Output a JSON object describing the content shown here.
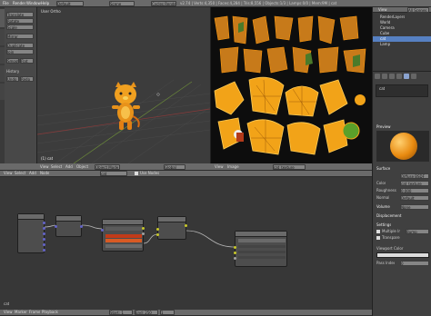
{
  "topbar": {
    "menus": [
      "File",
      "Render",
      "Window",
      "Help"
    ],
    "layout": "Default",
    "scene": "Scene",
    "engine": "Cycles Render",
    "info": "v2.74 | Verts:4,350 | Faces:4,284 | Tris:8,556 | Objects:1/3 | Lamps:0/0 | Mem:9M | cat"
  },
  "viewport": {
    "label": "User Ortho",
    "object_label": "(1) cat",
    "header_items": [
      "View",
      "Select",
      "Add",
      "Object",
      "Object Mode",
      "Global"
    ]
  },
  "uv_editor": {
    "header_items": [
      "View",
      "Image",
      "cat_texture"
    ]
  },
  "outliner": {
    "header_items": [
      "View",
      "Search",
      "All Scenes"
    ],
    "rows": [
      "RenderLayers",
      "World",
      "Camera",
      "Cube",
      "cat",
      "Lamp"
    ]
  },
  "properties": {
    "tabs": [
      "Render",
      "Scene",
      "World",
      "Object",
      "Material",
      "Texture"
    ],
    "material_slot": "cat",
    "sections": [
      "Preview",
      "Surface",
      "Volume",
      "Displacement",
      "Settings"
    ],
    "surface_shader": "Diffuse BSDF",
    "color_label": "Color",
    "roughness_label": "Roughness",
    "roughness_value": "0.000",
    "normal_label": "Normal",
    "normal_value": "Default",
    "volume_label": "Volume",
    "volume_value": "None",
    "multiple_importance_label": "Multiple Importance",
    "transparent_shadows_label": "Transparent Shadows",
    "displacement_label": "Displacement",
    "displacement_value": "Bump",
    "viewport_color_label": "Viewport Color",
    "pass_index_label": "Pass Index",
    "pass_index_value": "0"
  },
  "node_editor": {
    "header_items": [
      "View",
      "Select",
      "Add",
      "Node",
      "cat",
      "Use Nodes"
    ],
    "footer": "cat",
    "nodes": [
      {
        "title": "Texture Coordinate",
        "outputs": [
          "Generated",
          "Normal",
          "UV",
          "Object",
          "Camera",
          "Window",
          "Reflection"
        ]
      },
      {
        "title": "Mapping",
        "outputs": [
          "Vector"
        ]
      },
      {
        "title": "Image Texture",
        "outputs": [
          "Color",
          "Alpha"
        ],
        "image": "cat_texture"
      },
      {
        "title": "Mix",
        "outputs": [
          "Color"
        ]
      },
      {
        "title": "Diffuse BSDF",
        "outputs": [
          "BSDF"
        ],
        "fields": [
          "Color",
          "Roughness",
          "Normal"
        ]
      },
      {
        "title": "Material Output",
        "outputs": [
          "Surface",
          "Volume",
          "Displacement"
        ]
      }
    ]
  },
  "left_toolbar": {
    "tabs": [
      "Tools",
      "Create",
      "Relations",
      "Animation",
      "Physics"
    ],
    "buttons": [
      "Translate",
      "Rotate",
      "Scale",
      "Mirror",
      "Duplicate",
      "Join",
      "Smooth",
      "Flat",
      "History",
      "Undo",
      "Redo"
    ]
  },
  "timeline": {
    "header_items": [
      "View",
      "Marker",
      "Frame",
      "Playback"
    ],
    "start": "Start: 1",
    "end": "End: 250",
    "current": "1"
  },
  "colors": {
    "accent_orange": "#e89a1e",
    "uv_bg": "#0d0d0d",
    "panel": "#393939",
    "header": "#6a6a6a",
    "selected_row": "#5680c2",
    "node_selected": "#c23a18"
  }
}
